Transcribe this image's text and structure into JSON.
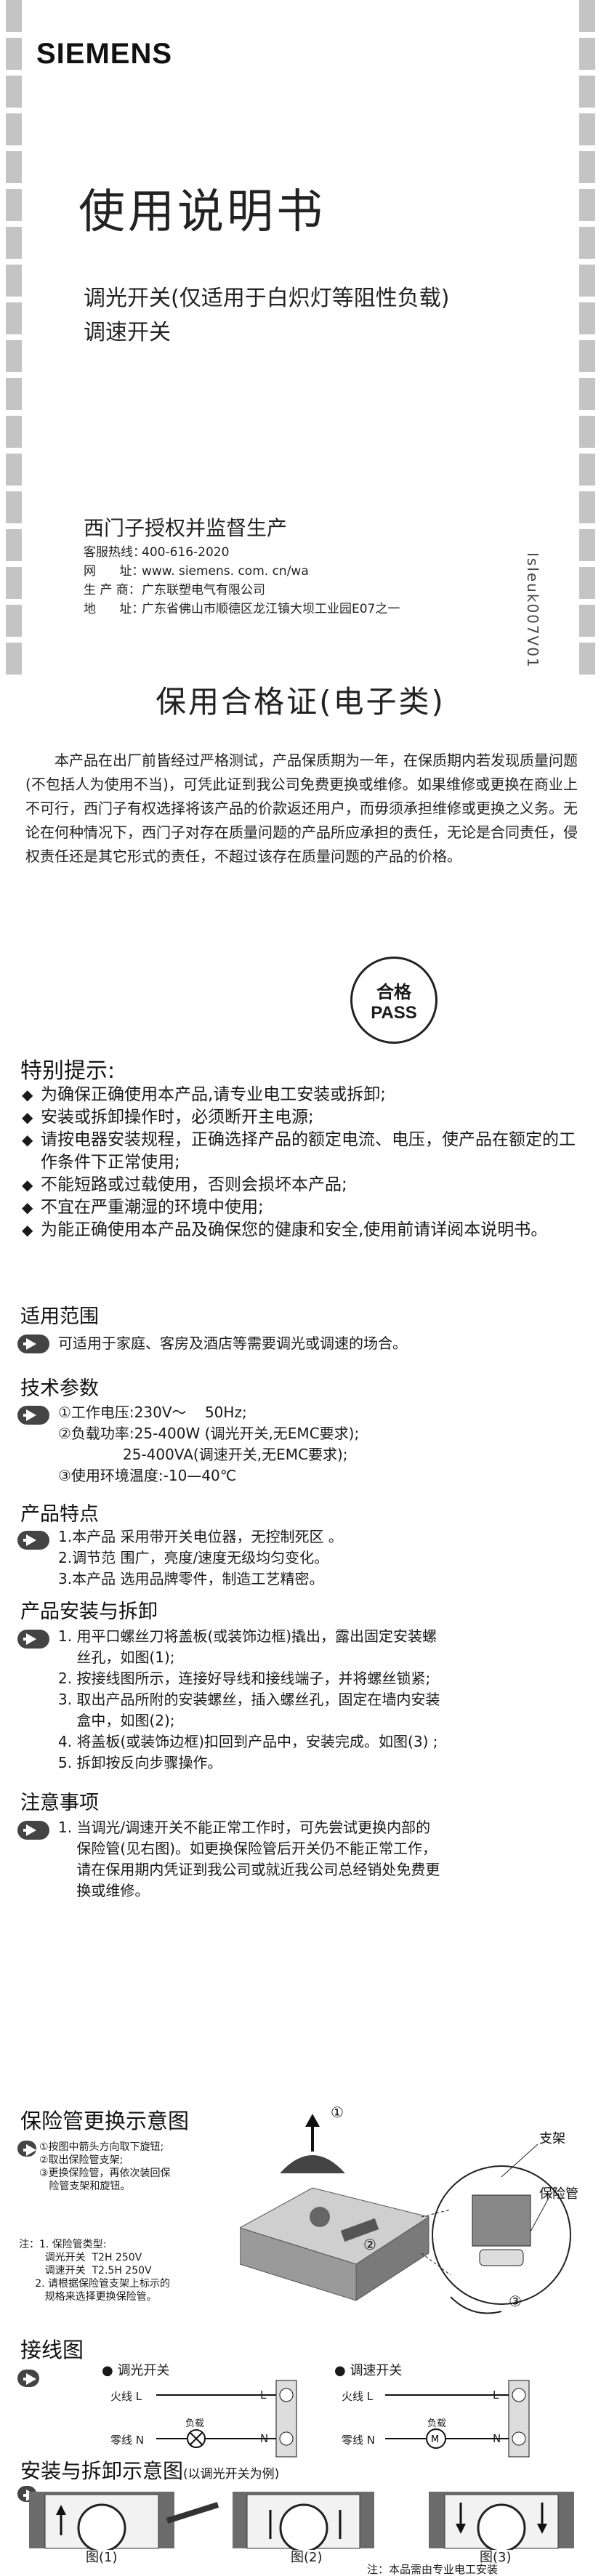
{
  "cover": {
    "brand": "SIEMENS",
    "title": "使用说明书",
    "product_line1": "调光开关(仅适用于白炽灯等阻性负载)",
    "product_line2": "调速开关",
    "maker": "西门子授权并监督生产",
    "info": [
      {
        "k": "客服热线：",
        "v": "400-616-2020"
      },
      {
        "k": "网      址：",
        "v": "www. siemens. com. cn/wa"
      },
      {
        "k": "生 产 商：",
        "v": "广东联塑电气有限公司"
      },
      {
        "k": "地      址：",
        "v": "广东省佛山市顺德区龙江镇大坝工业园E07之一"
      }
    ],
    "code": "Isleuk007V01"
  },
  "warranty": {
    "title": "保用合格证(电子类)",
    "text": "本产品在出厂前皆经过严格测试，产品保质期为一年，在保质期内若发现质量问题(不包括人为使用不当)，可凭此证到我公司免费更换或维修。如果维修或更换在商业上不可行，西门子有权选择将该产品的价款返还用户，而毋须承担维修或更换之义务。无论在何种情况下，西门子对存在质量问题的产品所应承担的责任，无论是合同责任，侵权责任还是其它形式的责任，不超过该存在质量问题的产品的价格。",
    "seal_cn": "合格",
    "seal_en": "PASS"
  },
  "notes": {
    "title": "特别提示:",
    "items": [
      "为确保正确使用本产品,请专业电工安装或拆卸;",
      "安装或拆卸操作时，必须断开主电源;",
      "请按电器安装规程，正确选择产品的额定电流、电压，使产品在额定的工作条件下正常使用;",
      "不能短路或过载使用，否则会损坏本产品;",
      "不宜在严重潮湿的环境中使用;",
      "为能正确使用本产品及确保您的健康和安全,使用前请详阅本说明书。"
    ]
  },
  "sections": {
    "scope": {
      "title": "适用范围",
      "lines": [
        "可适用于家庭、客房及酒店等需要调光或调速的场合。"
      ]
    },
    "tech": {
      "title": "技术参数",
      "lines": [
        "①工作电压:230V～    50Hz;",
        "②负载功率:25-400W (调光开关,无EMC要求);",
        "              25-400VA(调速开关,无EMC要求);",
        "③使用环境温度:-10—40℃"
      ]
    },
    "features": {
      "title": "产品特点",
      "lines": [
        "1.本产品 采用带开关电位器，无控制死区 。",
        "2.调节范 围广，亮度/速度无级均匀变化。",
        "3.本产品 选用品牌零件，制造工艺精密。"
      ]
    },
    "install": {
      "title": "产品安装与拆卸",
      "lines": [
        "1. 用平口螺丝刀将盖板(或装饰边框)撬出，露出固定安装螺",
        "    丝孔，如图(1);",
        "2. 按接线图所示，连接好导线和接线端子，并将螺丝锁紧;",
        "3. 取出产品所附的安装螺丝，插入螺丝孔，固定在墙内安装",
        "    盒中，如图(2);",
        "4. 将盖板(或装饰边框)扣回到产品中，安装完成。如图(3) ;",
        "5. 拆卸按反向步骤操作。"
      ]
    },
    "caution": {
      "title": "注意事项",
      "lines": [
        "1. 当调光/调速开关不能正常工作时，可先尝试更换内部的",
        "    保险管(见右图)。如更换保险管后开关仍不能正常工作，",
        "    请在保用期内凭证到我公司或就近我公司总经销处免费更",
        "    换或维修。"
      ]
    }
  },
  "fuse": {
    "title": "保险管更换示意图",
    "steps": [
      "①按图中箭头方向取下旋钮;",
      "②取出保险管支架;",
      "③更换保险管，再依次装回保",
      "   险管支架和旋钮。"
    ],
    "note": [
      "注：1. 保险管类型:",
      "        调光开关  T2H 250V",
      "        调速开关  T2.5H 250V",
      "     2. 请根据保险管支架上标示的",
      "        规格来选择更换保险管。"
    ],
    "label_bracket": "支架",
    "label_fuse": "保险管",
    "c1": "①",
    "c2": "②",
    "c3": "③"
  },
  "wiring": {
    "title": "接线图",
    "dimmer": "调光开关",
    "speed": "调速开关",
    "live": "火线 L",
    "neutral": "零线 N",
    "load": "负载",
    "L": "L",
    "N": "N"
  },
  "install_fig": {
    "title": "安装与拆卸示意图",
    "subtitle": "(以调光开关为例)",
    "fig1": "图(1)",
    "fig2": "图(2)",
    "fig3": "图(3)",
    "footnote": "注：本品需由专业电工安装"
  }
}
